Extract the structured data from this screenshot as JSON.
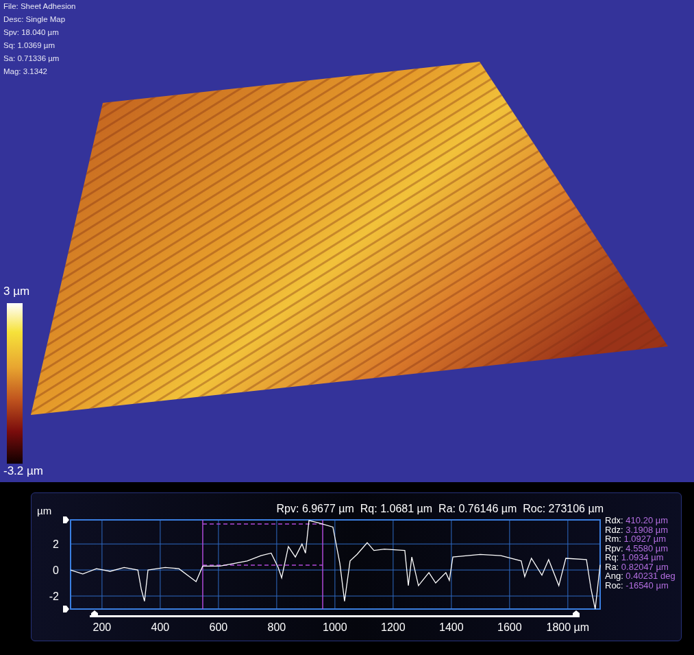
{
  "info_lines": [
    "File: Sheet Adhesion",
    "Desc: Single Map",
    "Spv: 18.040 µm",
    "Sq: 1.0369 µm",
    "Sa: 0.71336 µm",
    "Mag: 3.1342"
  ],
  "color_scale": {
    "max_label": "3 µm",
    "min_label": "-3.2 µm"
  },
  "profile": {
    "summary": [
      "Rpv: 6.9677 µm",
      "Rq: 1.0681 µm",
      "Ra: 0.76146 µm",
      "Roc: 273106 µm"
    ],
    "stats": [
      {
        "label": "Rdx:",
        "value": "410.20 µm"
      },
      {
        "label": "Rdz:",
        "value": "3.1908 µm"
      },
      {
        "label": "Rm:",
        "value": "1.0927 µm"
      },
      {
        "label": "Rpv:",
        "value": "4.5580 µm"
      },
      {
        "label": "Rq:",
        "value": "1.0934 µm"
      },
      {
        "label": "Ra:",
        "value": "0.82047 µm"
      },
      {
        "label": "Ang:",
        "value": "0.40231 deg"
      },
      {
        "label": "Roc:",
        "value": "-16540 µm"
      }
    ],
    "chart_data": {
      "type": "line",
      "ylabel": "µm",
      "x": [
        92,
        134,
        181,
        228,
        276,
        323,
        335,
        346,
        358,
        417,
        464,
        523,
        546,
        605,
        652,
        699,
        746,
        781,
        805,
        817,
        840,
        864,
        887,
        899,
        911,
        946,
        993,
        1017,
        1033,
        1052,
        1076,
        1111,
        1134,
        1170,
        1240,
        1252,
        1264,
        1287,
        1323,
        1346,
        1381,
        1393,
        1405,
        1499,
        1570,
        1640,
        1652,
        1675,
        1711,
        1734,
        1769,
        1793,
        1864,
        1880,
        1894,
        1911
      ],
      "series": [
        {
          "color": "#ffffff",
          "values": [
            0,
            -0.3,
            0.1,
            -0.1,
            0.2,
            0,
            -1.5,
            -2.4,
            0,
            0.2,
            0.1,
            -0.9,
            0.3,
            0.3,
            0.5,
            0.7,
            1.1,
            1.3,
            0.2,
            -0.6,
            1.8,
            1,
            2,
            1.3,
            3.8,
            3.6,
            3.3,
            0.5,
            -2.4,
            0.7,
            1.2,
            2.1,
            1.5,
            1.6,
            1.5,
            -1.2,
            1,
            -1.2,
            -0.2,
            -1,
            -0.2,
            -0.8,
            1,
            1.2,
            1.1,
            0.7,
            -0.5,
            0.9,
            -0.4,
            0.8,
            -1.2,
            0.9,
            0.8,
            -1.5,
            -3,
            0.4
          ]
        }
      ],
      "xlim": [
        92,
        1911
      ],
      "ylim": [
        -3,
        3.85
      ],
      "xticks": [
        200,
        400,
        600,
        800,
        1000,
        1200,
        1400,
        1600,
        {
          "value": 1800,
          "label": "1800 µm"
        }
      ],
      "yticks": [
        -2,
        0,
        2
      ],
      "grid": true,
      "ref_lines": [
        {
          "axis": "x",
          "value": 546,
          "color": "#b04ad8"
        },
        {
          "axis": "x",
          "value": 958,
          "color": "#b04ad8"
        }
      ]
    }
  }
}
